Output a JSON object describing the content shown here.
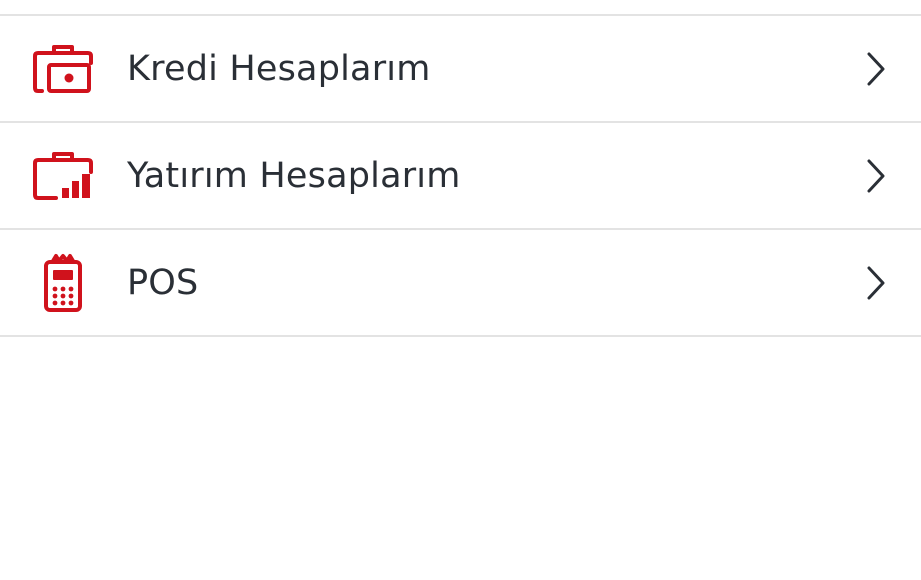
{
  "menu": {
    "items": [
      {
        "label": "Kredi Hesaplarım",
        "icon": "briefcase-money-icon"
      },
      {
        "label": "Yatırım Hesaplarım",
        "icon": "briefcase-chart-icon"
      },
      {
        "label": "POS",
        "icon": "pos-terminal-icon"
      }
    ]
  },
  "colors": {
    "accent": "#d0121c",
    "text": "#2a2f36",
    "divider": "#e3e3e3",
    "chevron": "#2a2f36"
  }
}
